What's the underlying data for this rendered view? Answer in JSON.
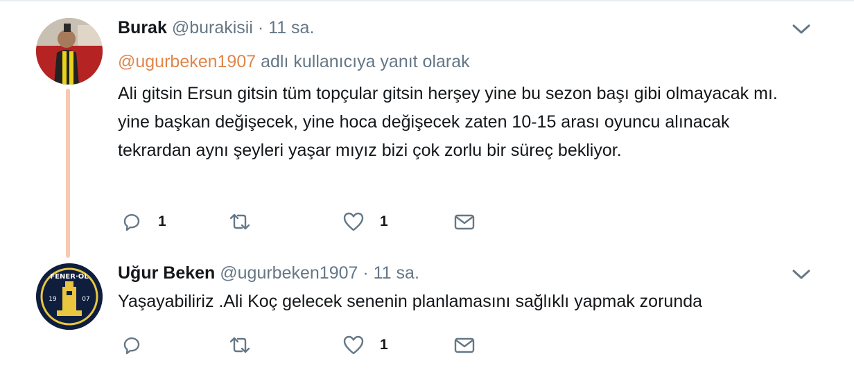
{
  "tweets": [
    {
      "name": "Burak",
      "handle": "@burakisii",
      "separator": "·",
      "time": "11 sa.",
      "avatar": "user-photo-avatar",
      "reply_prefix": "@ugurbeken1907",
      "reply_suffix": " adlı kullanıcıya yanıt olarak",
      "text": "Ali gitsin Ersun gitsin tüm topçular gitsin herşey yine bu sezon başı gibi olmayacak mı. yine başkan değişecek, yine hoca değişecek zaten 10-15 arası oyuncu alınacak tekrardan aynı şeyleri yaşar mıyız bizi çok zorlu bir süreç bekliyor.",
      "reply_count": "1",
      "retweet_count": "",
      "like_count": "1"
    },
    {
      "name": "Uğur Beken",
      "handle": "@ugurbeken1907",
      "separator": "·",
      "time": "11 sa.",
      "avatar": "fenerol-logo-avatar",
      "text": "Yaşayabiliriz .Ali Koç gelecek senenin planlamasını sağlıklı yapmak zorunda",
      "reply_count": "",
      "retweet_count": "",
      "like_count": "1"
    }
  ],
  "icons": {
    "reply": "reply-icon",
    "retweet": "retweet-icon",
    "like": "heart-icon",
    "dm": "envelope-icon",
    "menu": "chevron-down-icon"
  },
  "colors": {
    "text": "#14171a",
    "secondary": "#657786",
    "mention": "#e0864c",
    "thread_line": "#f7c9b0"
  }
}
